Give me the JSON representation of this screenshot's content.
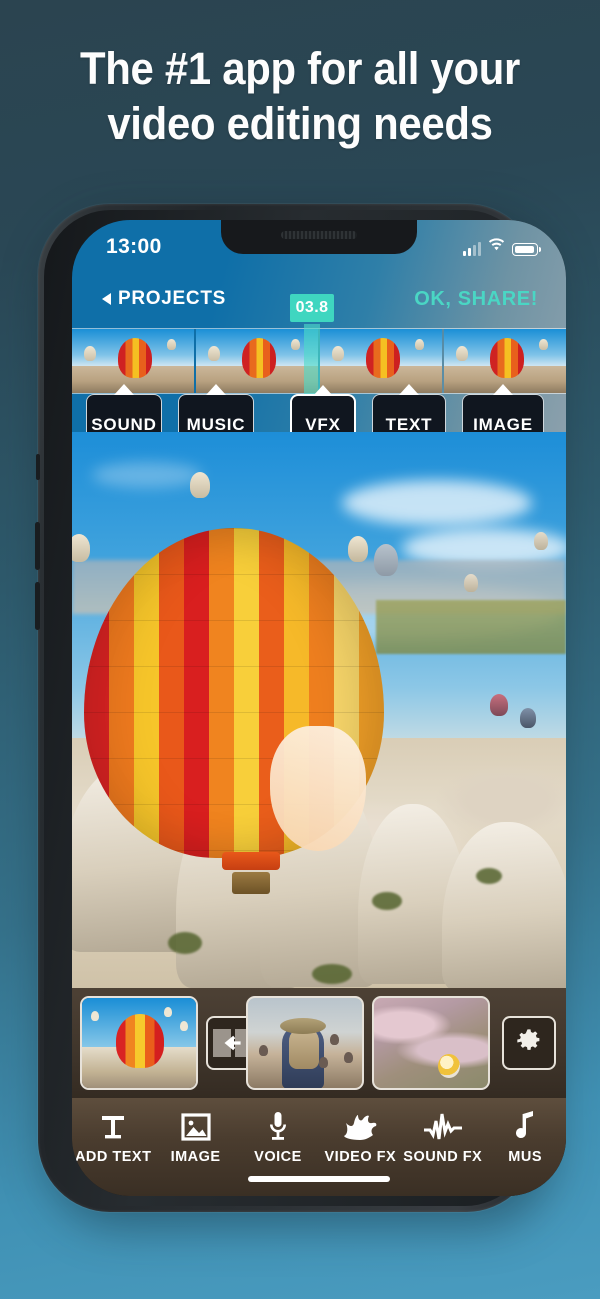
{
  "promo": {
    "headline_line1": "The #1 app for all your",
    "headline_line2": "video editing needs",
    "background_top_color": "#2b4450",
    "background_bottom_color": "#4a9cc0",
    "text_color": "#fdfdfd"
  },
  "phone": {
    "frame_color": "#2a2f33",
    "status_bar": {
      "time": "13:00",
      "cellular_icon": "cellular-signal-icon",
      "wifi_icon": "wifi-icon",
      "battery_icon": "battery-icon"
    },
    "home_indicator": "home-indicator"
  },
  "app": {
    "accent_color": "#4ad6c4",
    "nav": {
      "back_icon": "triangle-left-icon",
      "back_label": "PROJECTS",
      "share_label": "OK, SHARE!"
    },
    "timeline": {
      "playhead_time": "03.8",
      "playhead_color": "#3fd6c0",
      "thumbnail_count": 4,
      "track_chips": [
        {
          "label": "SOUND",
          "selected": false
        },
        {
          "label": "MUSIC",
          "selected": false
        },
        {
          "label": "VFX",
          "selected": true
        },
        {
          "label": "TEXT",
          "selected": false
        },
        {
          "label": "IMAGE",
          "selected": false
        }
      ]
    },
    "preview": {
      "description": "Hot air balloon over Cappadocia rock formations",
      "main_subject": "large red orange yellow checkered hot air balloon"
    },
    "clip_tray": {
      "clips": [
        {
          "name": "clip-balloon-sky"
        },
        {
          "name": "clip-woman-with-hat"
        },
        {
          "name": "clip-aerial-landscape"
        }
      ],
      "transition_button_icon": "transition-left-arrow-icon",
      "settings_button_icon": "gear-icon"
    },
    "toolbar": {
      "items": [
        {
          "label": "ADD TEXT",
          "icon": "text-t-icon"
        },
        {
          "label": "IMAGE",
          "icon": "image-icon"
        },
        {
          "label": "VOICE",
          "icon": "microphone-icon"
        },
        {
          "label": "VIDEO FX",
          "icon": "burst-star-icon"
        },
        {
          "label": "SOUND FX",
          "icon": "waveform-icon"
        },
        {
          "label": "MUS",
          "icon": "music-note-icon"
        }
      ]
    }
  }
}
